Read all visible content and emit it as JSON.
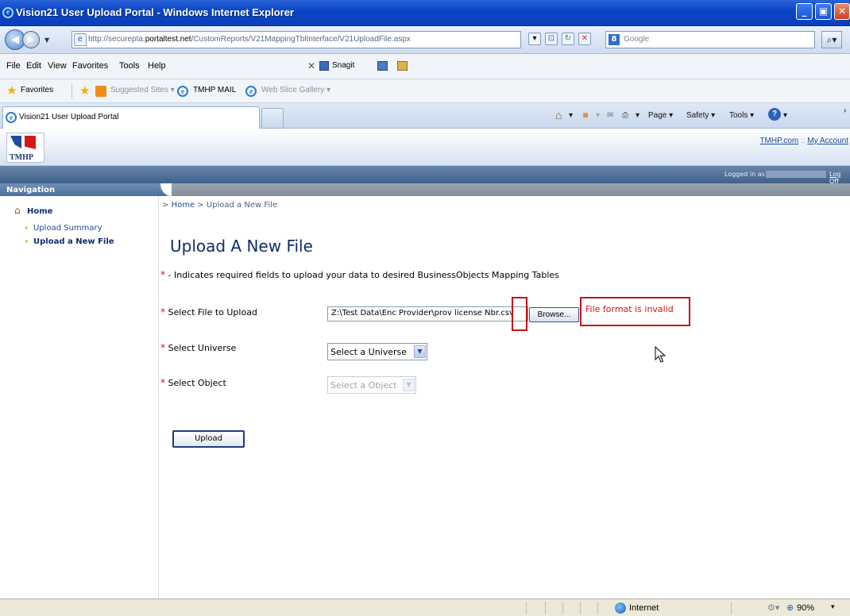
{
  "window": {
    "title": "Vision21 User Upload Portal - Windows Internet Explorer"
  },
  "address_bar": {
    "url_prefix": "http://securepta.",
    "url_domain": "portaltest.net",
    "url_path": "/CustomReports/V21MappingTblInterface/V21UploadFile.aspx"
  },
  "search": {
    "placeholder": "Google"
  },
  "menu": [
    "File",
    "Edit",
    "View",
    "Favorites",
    "Tools",
    "Help"
  ],
  "snagit": {
    "label": "Snagit"
  },
  "favorites_bar": {
    "favorites_label": "Favorites",
    "items": [
      "Suggested Sites ▾",
      "TMHP MAIL",
      "Web Slice Gallery ▾"
    ]
  },
  "tab": {
    "label": "Vision21 User Upload Portal"
  },
  "command_bar": {
    "page": "Page ▾",
    "safety": "Safety ▾",
    "tools": "Tools ▾"
  },
  "site": {
    "logo_text": "TMHP",
    "top_link_1": "TMHP.com",
    "top_link_sep": " :: ",
    "top_link_2": "My Account",
    "logged_in": "Logged in as",
    "log_off": "Log Off"
  },
  "nav": {
    "heading": "Navigation",
    "home": "Home",
    "items": [
      "Upload Summary",
      "Upload a New File"
    ]
  },
  "breadcrumb": {
    "prefix": "> ",
    "home": "Home",
    "sep": " > ",
    "current": "Upload a New File"
  },
  "page": {
    "title": "Upload A New File",
    "required_note": " - Indicates required fields to upload your data to desired BusinessObjects Mapping Tables",
    "req_star": "*"
  },
  "form": {
    "file_label": "Select File to Upload",
    "file_value": "Z:\\Test Data\\Enc Provider\\prov license Nbr.csv",
    "browse_label": "Browse...",
    "error": "File format is invalid",
    "universe_label": "Select Universe",
    "universe_value": "Select a Universe",
    "object_label": "Select Object",
    "object_value": "Select a Object",
    "upload_label": "Upload"
  },
  "status_bar": {
    "zone": "Internet",
    "zoom": "90%"
  }
}
